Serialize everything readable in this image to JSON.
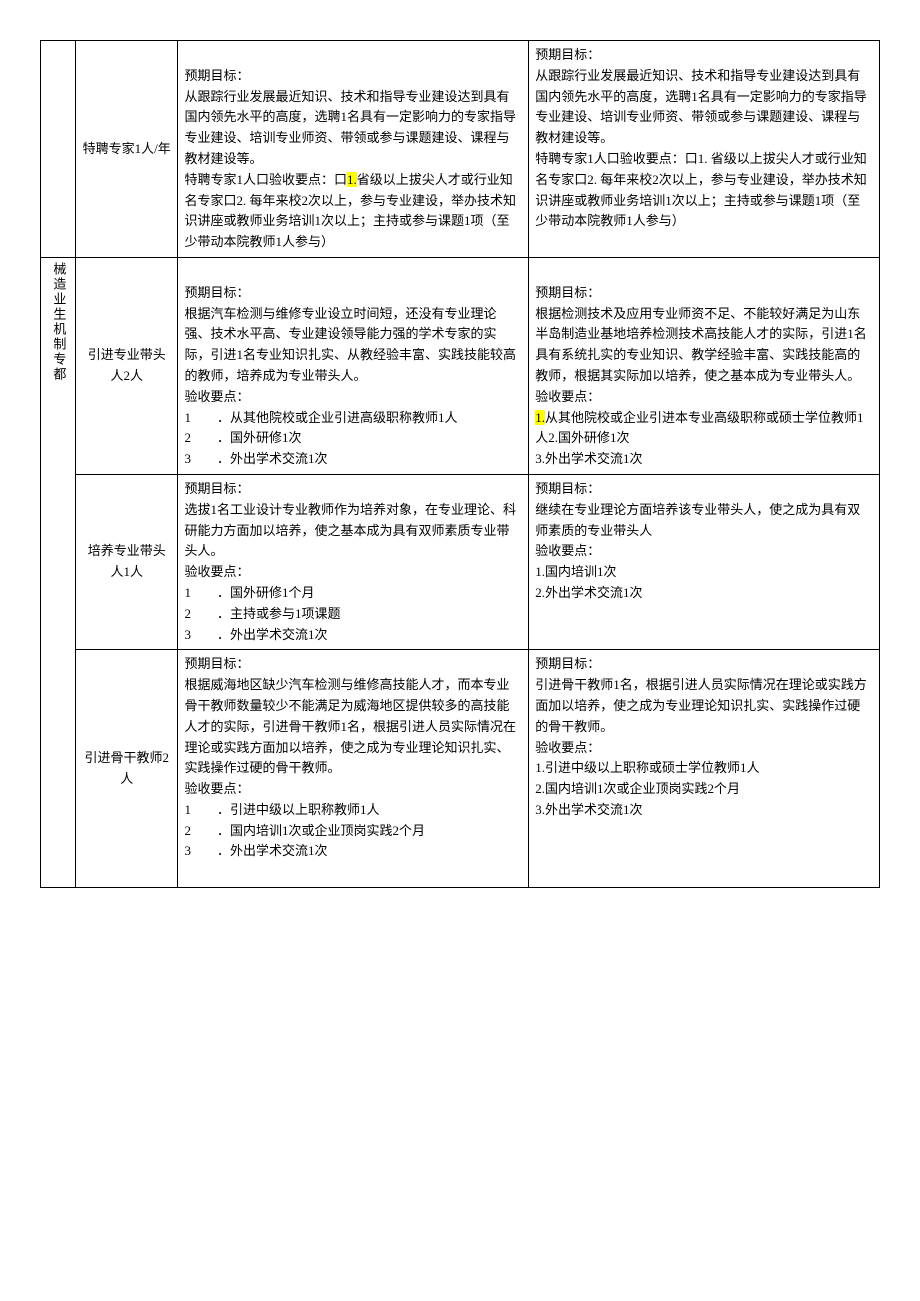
{
  "sideLabel": "械造业生机制专都",
  "rows": [
    {
      "label": "特聘专家1人/年",
      "left": {
        "t1": "预期目标：",
        "t2": "从跟踪行业发展最近知识、技术和指导专业建设达到具有国内领先水平的高度，选聘1名具有一定影响力的专家指导专业建设、培训专业师资、带领或参与课题建设、课程与教材建设等。",
        "t3a": "特聘专家1人口验收要点：口",
        "t3hl": "1.",
        "t3b": "省级以上拔尖人才或行业知名专家口2. 每年来校2次以上，参与专业建设，举办技术知识讲座或教师业务培训1次以上；主持或参与课题1项（至少带动本院教师1人参与）"
      },
      "right": {
        "t1": "预期目标：",
        "t2": "从跟踪行业发展最近知识、技术和指导专业建设达到具有国内领先水平的高度，选聘1名具有一定影响力的专家指导专业建设、培训专业师资、带领或参与课题建设、课程与教材建设等。",
        "t3": "特聘专家1人口验收要点：口1. 省级以上拔尖人才或行业知名专家口2. 每年来校2次以上，参与专业建设，举办技术知识讲座或教师业务培训1次以上；主持或参与课题1项（至少带动本院教师1人参与）"
      }
    },
    {
      "label": "引进专业带头人2人",
      "left": {
        "t1": "预期目标：",
        "t2": "根据汽车检测与维修专业设立时间短，还没有专业理论强、技术水平高、专业建设领导能力强的学术专家的实际，引进1名专业知识扎实、从教经验丰富、实践技能较高的教师，培养成为专业带头人。",
        "t3": "验收要点：",
        "i1a": "1",
        "i1b": "．从其他院校或企业引进高级职称教师1人",
        "i2a": "2",
        "i2b": "．国外研修1次",
        "i3a": "3",
        "i3b": "．外出学术交流1次"
      },
      "right": {
        "t1": "预期目标：",
        "t2": "根据检测技术及应用专业师资不足、不能较好满足为山东半岛制造业基地培养检测技术高技能人才的实际，引进1名具有系统扎实的专业知识、教学经验丰富、实践技能高的教师，根据其实际加以培养，使之基本成为专业带头人。",
        "t3": "验收要点：",
        "i1hl": "1.",
        "i1": "从其他院校或企业引进本专业高级职称或硕士学位教师1人2.国外研修1次",
        "i3": "3.外出学术交流1次"
      }
    },
    {
      "label": "培养专业带头人1人",
      "left": {
        "t1": "预期目标：",
        "t2": "选拔1名工业设计专业教师作为培养对象，在专业理论、科研能力方面加以培养，使之基本成为具有双师素质专业带头人。",
        "t3": "验收要点：",
        "i1a": "1",
        "i1b": "．国外研修1个月",
        "i2a": "2",
        "i2b": "．主持或参与1项课题",
        "i3a": "3",
        "i3b": "．外出学术交流1次"
      },
      "right": {
        "t1": "预期目标：",
        "t2": "继续在专业理论方面培养该专业带头人，使之成为具有双师素质的专业带头人",
        "t3": "验收要点：",
        "i1": "1.国内培训1次",
        "i2": "2.外出学术交流1次"
      }
    },
    {
      "label": "引进骨干教师2人",
      "left": {
        "t1": "预期目标：",
        "t2": "根据威海地区缺少汽车检测与维修高技能人才，而本专业骨干教师数量较少不能满足为威海地区提供较多的高技能人才的实际，引进骨干教师1名，根据引进人员实际情况在理论或实践方面加以培养，使之成为专业理论知识扎实、实践操作过硬的骨干教师。",
        "t3": "验收要点：",
        "i1a": "1",
        "i1b": "．引进中级以上职称教师1人",
        "i2a": "2",
        "i2b": "．国内培训1次或企业顶岗实践2个月",
        "i3a": "3",
        "i3b": "．外出学术交流1次"
      },
      "right": {
        "t1": "预期目标：",
        "t2": "引进骨干教师1名，根据引进人员实际情况在理论或实践方面加以培养，使之成为专业理论知识扎实、实践操作过硬的骨干教师。",
        "t3": "验收要点：",
        "i1": "1.引进中级以上职称或硕士学位教师1人",
        "i2": "2.国内培训1次或企业顶岗实践2个月",
        "i3": "3.外出学术交流1次"
      }
    }
  ]
}
